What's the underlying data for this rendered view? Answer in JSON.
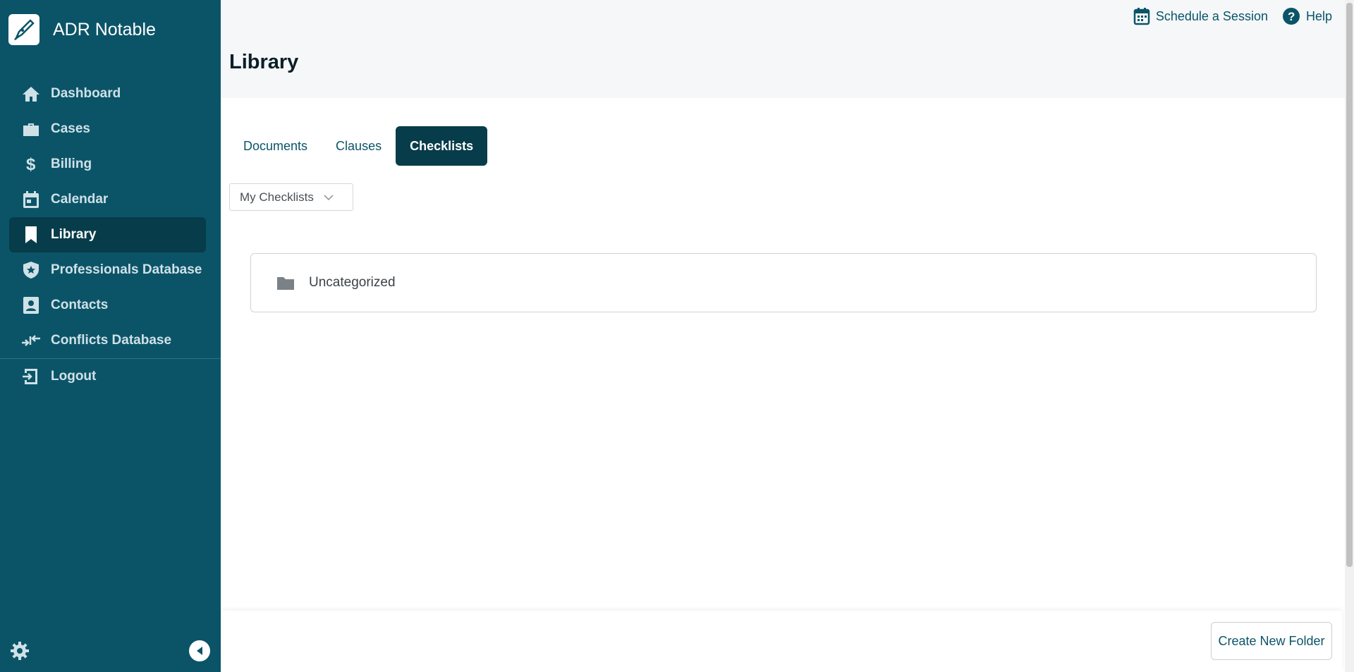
{
  "app": {
    "name": "ADR Notable",
    "logo_icon": "quill-pen-icon"
  },
  "sidebar": {
    "items": [
      {
        "label": "Dashboard",
        "icon": "home-icon",
        "active": false
      },
      {
        "label": "Cases",
        "icon": "briefcase-icon",
        "active": false
      },
      {
        "label": "Billing",
        "icon": "dollar-icon",
        "active": false
      },
      {
        "label": "Calendar",
        "icon": "calendar-icon",
        "active": false
      },
      {
        "label": "Library",
        "icon": "bookmark-icon",
        "active": true
      },
      {
        "label": "Professionals Database",
        "icon": "shield-star-icon",
        "active": false
      },
      {
        "label": "Contacts",
        "icon": "contact-card-icon",
        "active": false
      },
      {
        "label": "Conflicts Database",
        "icon": "arrows-converge-icon",
        "active": false
      }
    ],
    "logout": {
      "label": "Logout",
      "icon": "logout-icon"
    },
    "settings_icon": "gear-icon",
    "collapse_icon": "collapse-left-icon"
  },
  "header": {
    "title": "Library",
    "links": [
      {
        "label": "Schedule a Session",
        "icon": "calendar-icon"
      },
      {
        "label": "Help",
        "icon": "help-icon"
      }
    ]
  },
  "tabs": [
    {
      "label": "Documents",
      "active": false
    },
    {
      "label": "Clauses",
      "active": false
    },
    {
      "label": "Checklists",
      "active": true
    }
  ],
  "filter": {
    "selected": "My Checklists"
  },
  "folders": [
    {
      "name": "Uncategorized",
      "icon": "folder-icon"
    }
  ],
  "footer": {
    "create_label": "Create New Folder"
  },
  "colors": {
    "sidebar": "#0b5468",
    "active": "#073c4a",
    "accent": "#0b5468"
  }
}
